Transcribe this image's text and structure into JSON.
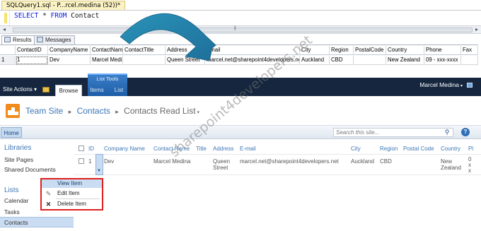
{
  "ssms": {
    "query_tab": "SQLQuery1.sql - P...rcel.medina (52))*",
    "sql": {
      "select": "SELECT",
      "star": "*",
      "from": "FROM",
      "table": "Contact"
    },
    "result_tabs": [
      "Results",
      "Messages"
    ],
    "columns": [
      "ContactID",
      "CompanyName",
      "ContactName",
      "ContactTitle",
      "Address",
      "Email",
      "City",
      "Region",
      "PostalCode",
      "Country",
      "Phone",
      "Fax"
    ],
    "row": {
      "num": "1",
      "cells": [
        "1",
        "Dev",
        "Marcel Medina",
        "",
        "Queen Street",
        "marcel.net@sharepoint4developers.net",
        "Auckland",
        "CBD",
        "",
        "New Zealand",
        "09 - xxx-xxxx",
        ""
      ]
    }
  },
  "ribbon": {
    "site_actions": "Site Actions",
    "list_tools": "List Tools",
    "tabs": [
      "Browse",
      "Items",
      "List"
    ],
    "user": "Marcel Medina"
  },
  "breadcrumb": {
    "site": "Team Site",
    "list": "Contacts",
    "view": "Contacts Read List"
  },
  "topnav": {
    "home": "Home",
    "search_placeholder": "Search this site..."
  },
  "quicklaunch": {
    "libraries": "Libraries",
    "library_items": [
      "Site Pages",
      "Shared Documents"
    ],
    "lists": "Lists",
    "list_items": [
      "Calendar",
      "Tasks",
      "Contacts"
    ]
  },
  "listview": {
    "headers": [
      "ID",
      "Company Name",
      "Contact Name",
      "Title",
      "Address",
      "E-mail",
      "City",
      "Region",
      "Postal Code",
      "Country",
      "Pl"
    ],
    "row": {
      "id": "1",
      "company": "Dev",
      "contact": "Marcel Medina",
      "title": "",
      "address_1": "Queen",
      "address_2": "Street",
      "email": "marcel.net@sharepoint4developers.net",
      "city": "Auckland",
      "region": "CBD",
      "postal": "",
      "country_1": "New",
      "country_2": "Zealand",
      "phone_1": "0",
      "phone_2": "x",
      "phone_3": "x"
    }
  },
  "context_menu": {
    "items": [
      "View Item",
      "Edit Item",
      "Delete Item"
    ]
  },
  "watermark": "sharepoint4developers.net",
  "colors": {
    "ribbon_bg": "#15263e",
    "link_blue": "#3d77b6",
    "menu_highlight": "#e02020",
    "arrow": "#2a93b8"
  },
  "icons": [
    "site-logo-icon",
    "folder-up-icon",
    "search-icon",
    "help-icon",
    "user-icon",
    "edit-item-icon",
    "delete-item-icon",
    "curved-arrow-icon"
  ]
}
